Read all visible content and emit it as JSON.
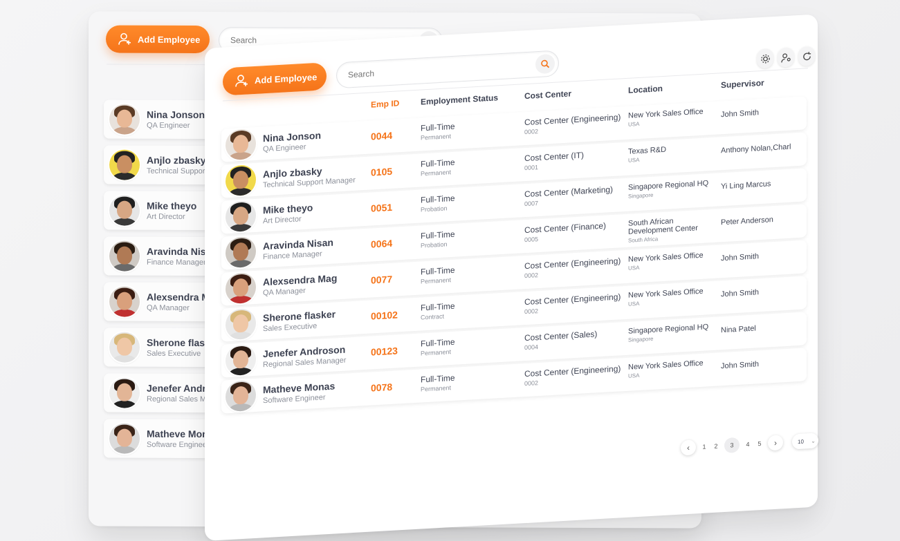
{
  "toolbar": {
    "add_label": "Add Employee",
    "search_placeholder": "Search"
  },
  "table": {
    "headers": {
      "emp_id": "Emp ID",
      "status": "Employment Status",
      "cost_center": "Cost Center",
      "location": "Location",
      "supervisor": "Supervisor"
    },
    "rows": [
      {
        "name": "Nina Jonson",
        "role": "QA Engineer",
        "id": "0044",
        "status": "Full-Time",
        "status_sub": "Permanent",
        "cc": "Cost Center (Engineering)",
        "cc_code": "0002",
        "loc": "New York Sales Office",
        "loc_sub": "USA",
        "sup": "John Smith"
      },
      {
        "name": "Anjlo zbasky",
        "role": "Technical Support Manager",
        "id": "0105",
        "status": "Full-Time",
        "status_sub": "Permanent",
        "cc": "Cost Center (IT)",
        "cc_code": "0001",
        "loc": "Texas R&D",
        "loc_sub": "USA",
        "sup": "Anthony Nolan,Charl"
      },
      {
        "name": "Mike theyo",
        "role": "Art Director",
        "id": "0051",
        "status": "Full-Time",
        "status_sub": "Probation",
        "cc": "Cost Center (Marketing)",
        "cc_code": "0007",
        "loc": "Singapore Regional HQ",
        "loc_sub": "Singapore",
        "sup": "Yi Ling Marcus"
      },
      {
        "name": "Aravinda Nisan",
        "role": "Finance Manager",
        "id": "0064",
        "status": "Full-Time",
        "status_sub": "Probation",
        "cc": "Cost Center (Finance)",
        "cc_code": "0005",
        "loc": "South African Development Center",
        "loc_sub": "South Africa",
        "sup": "Peter Anderson"
      },
      {
        "name": "Alexsendra Mag",
        "role": "QA Manager",
        "id": "0077",
        "status": "Full-Time",
        "status_sub": "Permanent",
        "cc": "Cost Center (Engineering)",
        "cc_code": "0002",
        "loc": "New York Sales Office",
        "loc_sub": "USA",
        "sup": "John Smith"
      },
      {
        "name": "Sherone flasker",
        "role": "Sales Executive",
        "id": "00102",
        "status": "Full-Time",
        "status_sub": "Contract",
        "cc": "Cost Center (Engineering)",
        "cc_code": "0002",
        "loc": "New York Sales Office",
        "loc_sub": "USA",
        "sup": "John Smith"
      },
      {
        "name": "Jenefer Androson",
        "role": "Regional Sales Manager",
        "id": "00123",
        "status": "Full-Time",
        "status_sub": "Permanent",
        "cc": "Cost Center (Sales)",
        "cc_code": "0004",
        "loc": "Singapore Regional HQ",
        "loc_sub": "Singapore",
        "sup": "Nina Patel"
      },
      {
        "name": "Matheve Monas",
        "role": "Software Engineer",
        "id": "0078",
        "status": "Full-Time",
        "status_sub": "Permanent",
        "cc": "Cost Center (Engineering)",
        "cc_code": "0002",
        "loc": "New York Sales Office",
        "loc_sub": "USA",
        "sup": "John Smith"
      }
    ]
  },
  "back_list": [
    {
      "name": "Nina Jonson",
      "role": "QA Engineer"
    },
    {
      "name": "Anjlo zbasky",
      "role": "Technical Support M"
    },
    {
      "name": "Mike theyo",
      "role": "Art Director"
    },
    {
      "name": "Aravinda Nisan",
      "role": "Finance Manager"
    },
    {
      "name": "Alexsendra Mag",
      "role": "QA Manager"
    },
    {
      "name": "Sherone flasker",
      "role": "Sales Executive"
    },
    {
      "name": "Jenefer Androson",
      "role": "Regional Sales Mana"
    },
    {
      "name": "Matheve Monas",
      "role": "Software Engineer"
    }
  ],
  "pagination": {
    "prev": "‹",
    "next": "›",
    "pages": [
      "1",
      "2",
      "3",
      "4",
      "5"
    ],
    "active": "3",
    "page_size": "10"
  },
  "icons": {
    "add": "add-user-icon",
    "search": "search-icon",
    "settings": "gear-icon",
    "user_settings": "user-gear-icon",
    "refresh": "refresh-icon"
  },
  "colors": {
    "accent": "#f5741a",
    "text": "#3f4454",
    "muted": "#8c909a"
  }
}
